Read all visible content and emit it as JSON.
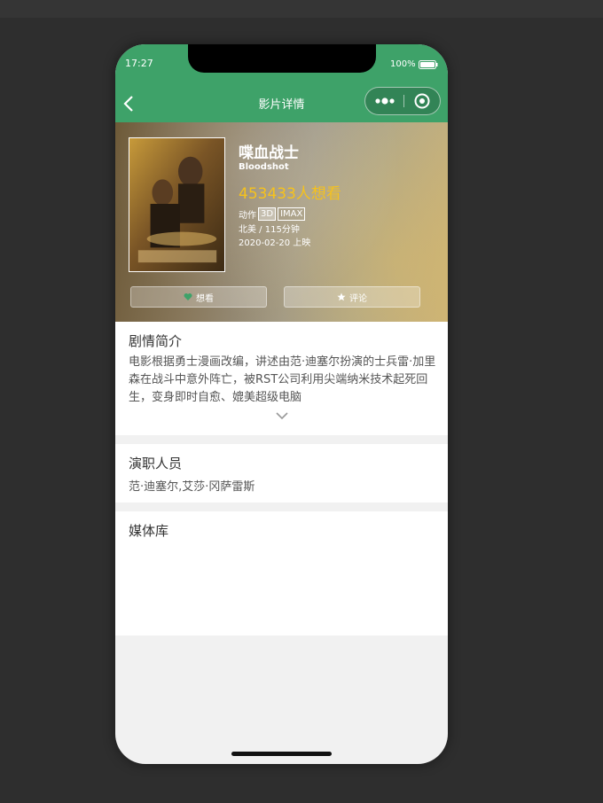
{
  "status": {
    "time": "17:27",
    "battery": "100%"
  },
  "nav": {
    "title": "影片详情"
  },
  "movie": {
    "title": "喋血战士",
    "title_en": "Bloodshot",
    "want_count": "453433人想看",
    "genre": "动作",
    "tags": [
      "3D",
      "IMAX"
    ],
    "region_duration": "北美 / 115分钟",
    "release": "2020-02-20 上映"
  },
  "actions": {
    "want_label": "想看",
    "comment_label": "评论"
  },
  "synopsis": {
    "title": "剧情简介",
    "text": "电影根据勇士漫画改编，讲述由范·迪塞尔扮演的士兵雷·加里森在战斗中意外阵亡，被RST公司利用尖端纳米技术起死回生，变身即时自愈、媲美超级电脑"
  },
  "cast": {
    "title": "演职人员",
    "text": "范·迪塞尔,艾莎·冈萨雷斯"
  },
  "media": {
    "title": "媒体库"
  },
  "colors": {
    "brand": "#3ea269",
    "accent": "#f6c21c",
    "heart": "#3ea269"
  },
  "icons": {
    "back": "chevron-left-icon",
    "more": "more-dots-icon",
    "close": "target-close-icon",
    "want": "heart-icon",
    "comment": "star-icon",
    "expand": "chevron-down-icon"
  }
}
